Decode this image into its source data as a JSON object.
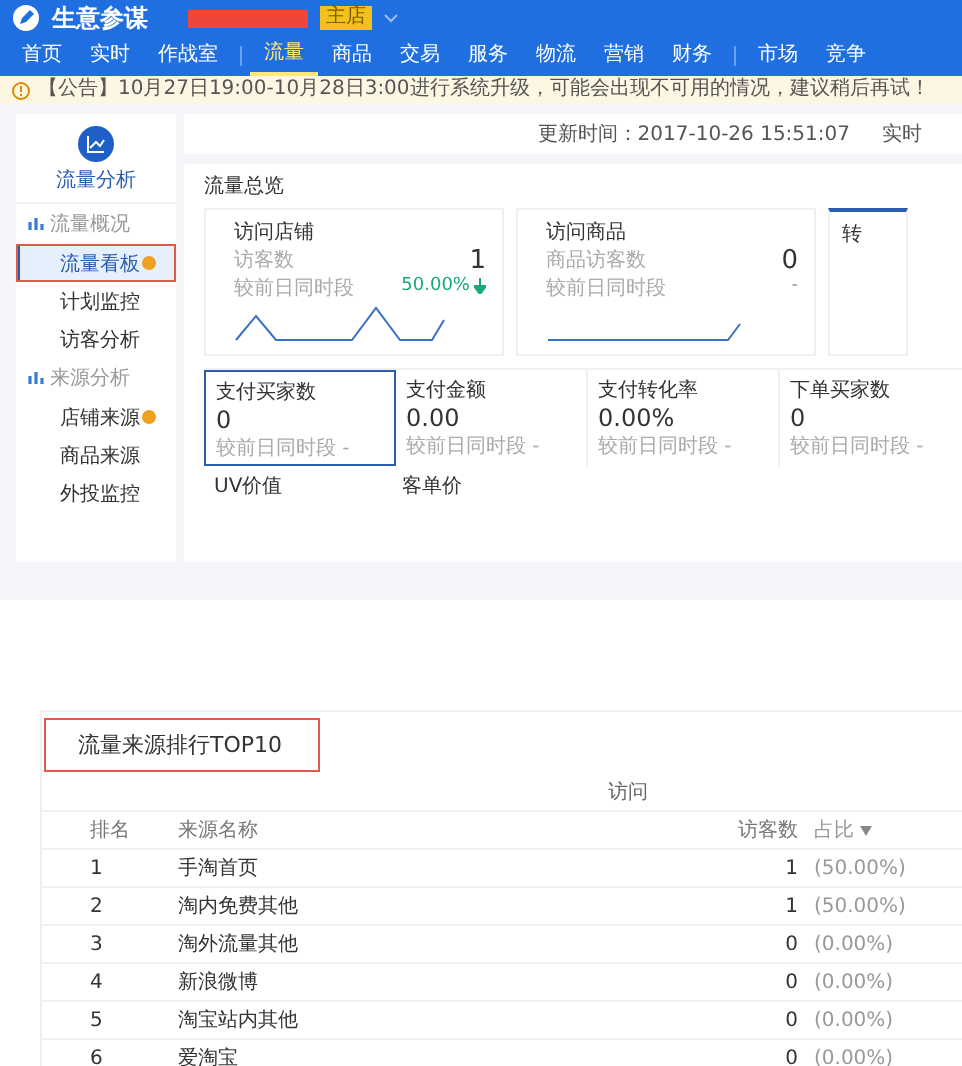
{
  "header": {
    "title": "生意参谋",
    "badge": "主店"
  },
  "nav": [
    [
      {
        "label": "首页",
        "selected": false
      },
      {
        "label": "实时",
        "selected": false
      },
      {
        "label": "作战室",
        "selected": false
      }
    ],
    [
      {
        "label": "流量",
        "selected": true
      },
      {
        "label": "商品",
        "selected": false
      },
      {
        "label": "交易",
        "selected": false
      },
      {
        "label": "服务",
        "selected": false
      },
      {
        "label": "物流",
        "selected": false
      },
      {
        "label": "营销",
        "selected": false
      },
      {
        "label": "财务",
        "selected": false
      }
    ],
    [
      {
        "label": "市场",
        "selected": false
      },
      {
        "label": "竞争",
        "selected": false
      }
    ]
  ],
  "notice": "【公告】10月27日19:00-10月28日3:00进行系统升级，可能会出现不可用的情况，建议稍后再试！",
  "sidebar": {
    "title": "流量分析",
    "groups": [
      {
        "label": "流量概况",
        "items": [
          {
            "label": "流量看板",
            "selected": true,
            "dot": true,
            "highlighted": true
          },
          {
            "label": "计划监控",
            "selected": false,
            "dot": false,
            "highlighted": false
          },
          {
            "label": "访客分析",
            "selected": false,
            "dot": false,
            "highlighted": false
          }
        ]
      },
      {
        "label": "来源分析",
        "items": [
          {
            "label": "店铺来源",
            "selected": false,
            "dot": true,
            "highlighted": false
          },
          {
            "label": "商品来源",
            "selected": false,
            "dot": false,
            "highlighted": false
          },
          {
            "label": "外投监控",
            "selected": false,
            "dot": false,
            "highlighted": false
          }
        ]
      }
    ]
  },
  "toolbar": {
    "update_time": "更新时间：2017-10-26 15:51:07",
    "mode": "实时"
  },
  "overview": {
    "title": "流量总览",
    "cards": [
      {
        "title": "访问店铺",
        "metric": "访客数",
        "compare": "较前日同时段",
        "value": "1",
        "change": "50.00%",
        "falling": true
      },
      {
        "title": "访问商品",
        "metric": "商品访客数",
        "compare": "较前日同时段",
        "value": "0",
        "change": "-",
        "falling": false
      },
      {
        "title": "转"
      }
    ],
    "metrics": [
      {
        "label": "支付买家数",
        "value": "0",
        "compare": "较前日同时段",
        "change": "-",
        "selected": true
      },
      {
        "label": "支付金额",
        "value": "0.00",
        "compare": "较前日同时段",
        "change": "-",
        "selected": false
      },
      {
        "label": "支付转化率",
        "value": "0.00%",
        "compare": "较前日同时段",
        "change": "-",
        "selected": false
      },
      {
        "label": "下单买家数",
        "value": "0",
        "compare": "较前日同时段",
        "change": "-",
        "selected": false
      }
    ],
    "more": [
      "UV价值",
      "客单价"
    ]
  },
  "ranking": {
    "title": "流量来源排行TOP10",
    "highlighted": true,
    "group_header": "访问",
    "columns": [
      {
        "label": "排名",
        "sorted": false
      },
      {
        "label": "来源名称",
        "sorted": false
      },
      {
        "label": "访客数",
        "sorted": false
      },
      {
        "label": "占比",
        "sorted": true
      }
    ],
    "rows": [
      [
        "1",
        "手淘首页",
        "1",
        "(50.00%)"
      ],
      [
        "2",
        "淘内免费其他",
        "1",
        "(50.00%)"
      ],
      [
        "3",
        "淘外流量其他",
        "0",
        "(0.00%)"
      ],
      [
        "4",
        "新浪微博",
        "0",
        "(0.00%)"
      ],
      [
        "5",
        "淘宝站内其他",
        "0",
        "(0.00%)"
      ],
      [
        "6",
        "爱淘宝",
        "0",
        "(0.00%)"
      ]
    ]
  }
}
